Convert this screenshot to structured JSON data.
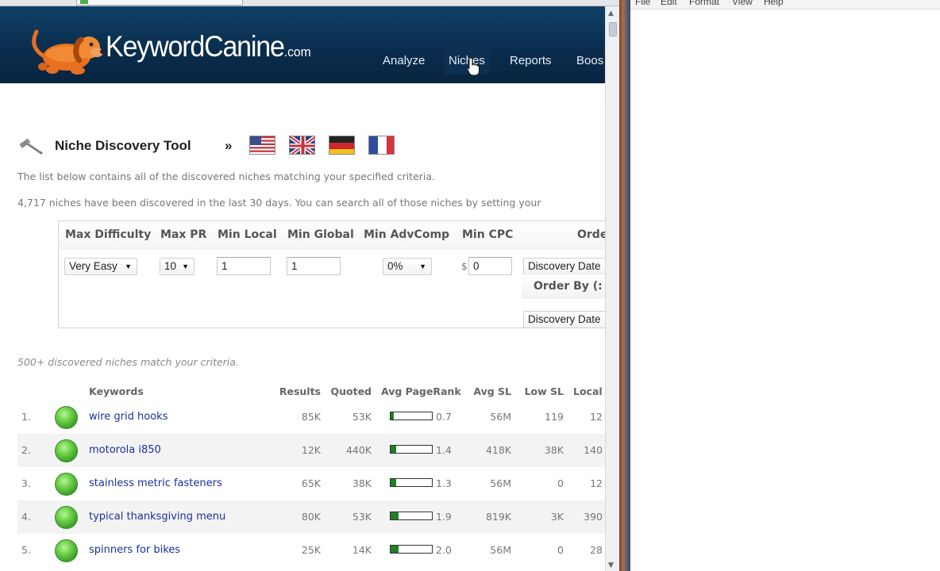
{
  "brand": {
    "name": "KeywordCanine",
    "suffix": ".com"
  },
  "nav": [
    {
      "label": "Analyze"
    },
    {
      "label": "Niches"
    },
    {
      "label": "Reports"
    },
    {
      "label": "Boos"
    }
  ],
  "tool": {
    "title": "Niche Discovery Tool",
    "separator": "»",
    "flags": [
      "us-flag-icon",
      "uk-flag-icon",
      "germany-flag-icon",
      "france-flag-icon"
    ]
  },
  "intro": {
    "line1": "The list below contains all of the discovered niches matching your specified criteria.",
    "line2": "4,717 niches have been discovered in the last 30 days. You can search all of those niches by setting your"
  },
  "filters": {
    "headers": [
      "Max Difficulty",
      "Max PR",
      "Min Local",
      "Min Global",
      "Min AdvComp",
      "Min CPC",
      "Orde"
    ],
    "max_difficulty": "Very Easy",
    "max_pr": "10",
    "min_local": "1",
    "min_global": "1",
    "min_advcomp": "0%",
    "currency": "$",
    "min_cpc": "0",
    "order_1": "Discovery Date",
    "order_by_label": "Order By (:",
    "order_2": "Discovery Date"
  },
  "match_note": "500+ discovered niches match your criteria.",
  "table": {
    "headers": {
      "keywords": "Keywords",
      "results": "Results",
      "quoted": "Quoted",
      "avg_pagerank": "Avg PageRank",
      "avg_sl": "Avg SL",
      "low_sl": "Low SL",
      "local": "Local"
    },
    "rows": [
      {
        "num": "1.",
        "keyword": "wire grid hooks",
        "results": "85K",
        "quoted": "53K",
        "pagerank": "0.7",
        "pagerank_fraction": 0.07,
        "avg_sl": "56M",
        "low_sl": "119",
        "local": "12"
      },
      {
        "num": "2.",
        "keyword": "motorola i850",
        "results": "12K",
        "quoted": "440K",
        "pagerank": "1.4",
        "pagerank_fraction": 0.14,
        "avg_sl": "418K",
        "low_sl": "38K",
        "local": "140"
      },
      {
        "num": "3.",
        "keyword": "stainless metric fasteners",
        "results": "65K",
        "quoted": "38K",
        "pagerank": "1.3",
        "pagerank_fraction": 0.13,
        "avg_sl": "56M",
        "low_sl": "0",
        "local": "12"
      },
      {
        "num": "4.",
        "keyword": "typical thanksgiving menu",
        "results": "80K",
        "quoted": "53K",
        "pagerank": "1.9",
        "pagerank_fraction": 0.19,
        "avg_sl": "819K",
        "low_sl": "3K",
        "local": "390"
      },
      {
        "num": "5.",
        "keyword": "spinners for bikes",
        "results": "25K",
        "quoted": "14K",
        "pagerank": "2.0",
        "pagerank_fraction": 0.2,
        "avg_sl": "56M",
        "low_sl": "0",
        "local": "28"
      }
    ]
  },
  "notepad": {
    "menu": [
      "File",
      "Edit",
      "Format",
      "View",
      "Help"
    ]
  },
  "colors": {
    "header_bg": "#0a2c4c",
    "link": "#1b2f9a",
    "status_green": "#4cbb34",
    "pagerank_fill": "#1f7f25"
  }
}
